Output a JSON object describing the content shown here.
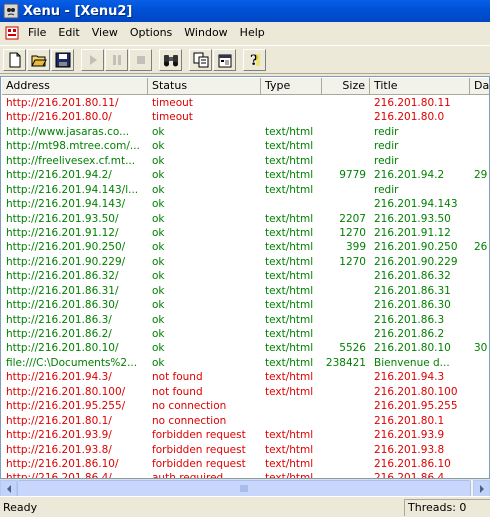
{
  "window": {
    "title": "Xenu - [Xenu2]"
  },
  "menu": {
    "items": [
      "File",
      "Edit",
      "View",
      "Options",
      "Window",
      "Help"
    ]
  },
  "toolbar": {
    "buttons": [
      "new-document-icon",
      "open-folder-icon",
      "save-disk-icon",
      "play-icon",
      "pause-icon",
      "stop-icon",
      "binoculars-icon",
      "copy-icon",
      "properties-icon",
      "help-question-icon"
    ]
  },
  "columns": [
    "Address",
    "Status",
    "Type",
    "Size",
    "Title",
    "Dat"
  ],
  "colors": {
    "ok": "#008000",
    "error": "#e00000"
  },
  "rows": [
    {
      "address": "http://216.201.80.11/",
      "status": "timeout",
      "type": "",
      "size": "",
      "title": "216.201.80.11",
      "date": "",
      "color": "#e00000"
    },
    {
      "address": "http://216.201.80.0/",
      "status": "timeout",
      "type": "",
      "size": "",
      "title": "216.201.80.0",
      "date": "",
      "color": "#e00000"
    },
    {
      "address": "http://www.jasaras.co...",
      "status": "ok",
      "type": "text/html",
      "size": "",
      "title": "redir",
      "date": "",
      "color": "#008000"
    },
    {
      "address": "http://mt98.mtree.com/...",
      "status": "ok",
      "type": "text/html",
      "size": "",
      "title": "redir",
      "date": "",
      "color": "#008000"
    },
    {
      "address": "http://freelivesex.cf.mt...",
      "status": "ok",
      "type": "text/html",
      "size": "",
      "title": "redir",
      "date": "",
      "color": "#008000"
    },
    {
      "address": "http://216.201.94.2/",
      "status": "ok",
      "type": "text/html",
      "size": "9779",
      "title": "216.201.94.2",
      "date": "29",
      "color": "#008000"
    },
    {
      "address": "http://216.201.94.143/l...",
      "status": "ok",
      "type": "text/html",
      "size": "",
      "title": "redir",
      "date": "",
      "color": "#008000"
    },
    {
      "address": "http://216.201.94.143/",
      "status": "ok",
      "type": "",
      "size": "",
      "title": "216.201.94.143",
      "date": "",
      "color": "#008000"
    },
    {
      "address": "http://216.201.93.50/",
      "status": "ok",
      "type": "text/html",
      "size": "2207",
      "title": "216.201.93.50",
      "date": "",
      "color": "#008000"
    },
    {
      "address": "http://216.201.91.12/",
      "status": "ok",
      "type": "text/html",
      "size": "1270",
      "title": "216.201.91.12",
      "date": "",
      "color": "#008000"
    },
    {
      "address": "http://216.201.90.250/",
      "status": "ok",
      "type": "text/html",
      "size": "399",
      "title": "216.201.90.250",
      "date": "26",
      "color": "#008000"
    },
    {
      "address": "http://216.201.90.229/",
      "status": "ok",
      "type": "text/html",
      "size": "1270",
      "title": "216.201.90.229",
      "date": "",
      "color": "#008000"
    },
    {
      "address": "http://216.201.86.32/",
      "status": "ok",
      "type": "text/html",
      "size": "",
      "title": "216.201.86.32",
      "date": "",
      "color": "#008000"
    },
    {
      "address": "http://216.201.86.31/",
      "status": "ok",
      "type": "text/html",
      "size": "",
      "title": "216.201.86.31",
      "date": "",
      "color": "#008000"
    },
    {
      "address": "http://216.201.86.30/",
      "status": "ok",
      "type": "text/html",
      "size": "",
      "title": "216.201.86.30",
      "date": "",
      "color": "#008000"
    },
    {
      "address": "http://216.201.86.3/",
      "status": "ok",
      "type": "text/html",
      "size": "",
      "title": "216.201.86.3",
      "date": "",
      "color": "#008000"
    },
    {
      "address": "http://216.201.86.2/",
      "status": "ok",
      "type": "text/html",
      "size": "",
      "title": "216.201.86.2",
      "date": "",
      "color": "#008000"
    },
    {
      "address": "http://216.201.80.10/",
      "status": "ok",
      "type": "text/html",
      "size": "5526",
      "title": "216.201.80.10",
      "date": "30",
      "color": "#008000"
    },
    {
      "address": "file:///C:\\Documents%2...",
      "status": "ok",
      "type": "text/html",
      "size": "238421",
      "title": "Bienvenue d...",
      "date": "",
      "color": "#008000"
    },
    {
      "address": "http://216.201.94.3/",
      "status": "not found",
      "type": "text/html",
      "size": "",
      "title": "216.201.94.3",
      "date": "",
      "color": "#e00000"
    },
    {
      "address": "http://216.201.80.100/",
      "status": "not found",
      "type": "text/html",
      "size": "",
      "title": "216.201.80.100",
      "date": "",
      "color": "#e00000"
    },
    {
      "address": "http://216.201.95.255/",
      "status": "no connection",
      "type": "",
      "size": "",
      "title": "216.201.95.255",
      "date": "",
      "color": "#e00000"
    },
    {
      "address": "http://216.201.80.1/",
      "status": "no connection",
      "type": "",
      "size": "",
      "title": "216.201.80.1",
      "date": "",
      "color": "#e00000"
    },
    {
      "address": "http://216.201.93.9/",
      "status": "forbidden request",
      "type": "text/html",
      "size": "",
      "title": "216.201.93.9",
      "date": "",
      "color": "#e00000"
    },
    {
      "address": "http://216.201.93.8/",
      "status": "forbidden request",
      "type": "text/html",
      "size": "",
      "title": "216.201.93.8",
      "date": "",
      "color": "#e00000"
    },
    {
      "address": "http://216.201.86.10/",
      "status": "forbidden request",
      "type": "text/html",
      "size": "",
      "title": "216.201.86.10",
      "date": "",
      "color": "#e00000"
    },
    {
      "address": "http://216.201.86.4/",
      "status": "auth required",
      "type": "text/html",
      "size": "",
      "title": "216.201.86.4",
      "date": "",
      "color": "#e00000"
    }
  ],
  "statusbar": {
    "ready": "Ready",
    "threads": "Threads: 0"
  }
}
